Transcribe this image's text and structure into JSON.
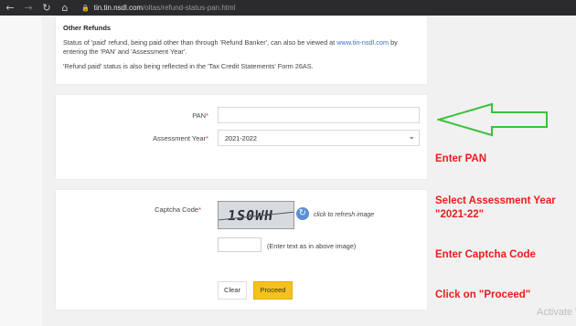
{
  "browser": {
    "url_host": "tin.tin.nsdl.com",
    "url_path": "/oltas/refund-status-pan.html"
  },
  "info": {
    "heading": "Other Refunds",
    "para1_pre": "Status of 'paid' refund, being paid other than through 'Refund Banker', can also be viewed at ",
    "para1_link": "www.tin-nsdl.com",
    "para1_post": " by entering the 'PAN' and 'Assessment Year'.",
    "para2": "'Refund paid' status is also being reflected in the 'Tax Credit Statements' Form 26AS."
  },
  "form": {
    "pan_label": "PAN",
    "ay_label": "Assessment Year",
    "required_mark": "*",
    "pan_value": "",
    "ay_selected": "2021-2022",
    "captcha_label": "Captcha Code",
    "captcha_image_text": "1S0WH",
    "refresh_text": "click to refresh image",
    "captcha_value": "",
    "captcha_hint": "(Enter text as in above image)",
    "clear_label": "Clear",
    "proceed_label": "Proceed"
  },
  "annotations": {
    "enter_pan": "Enter PAN",
    "select_ay_line1": "Select Assessment Year",
    "select_ay_line2": "\"2021-22\"",
    "enter_captcha": "Enter Captcha Code",
    "click_proceed": "Click on \"Proceed\"",
    "arrow_color": "#3cc13c",
    "text_color": "#ee1b1b"
  },
  "watermark": "Activate W",
  "colors": {
    "proceed_button": "#f4c21c",
    "link": "#3d6ec9",
    "required": "#d0352c"
  }
}
